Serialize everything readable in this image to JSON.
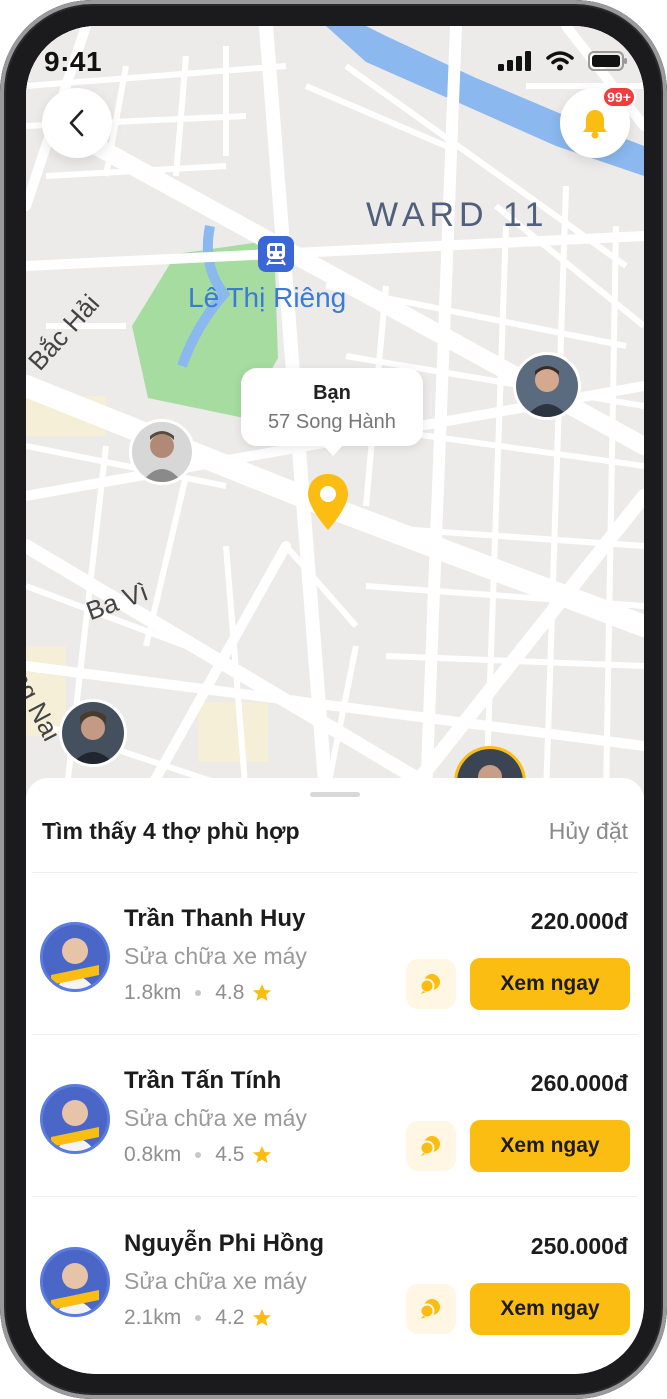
{
  "status_bar": {
    "time": "9:41"
  },
  "notifications": {
    "badge": "99+"
  },
  "map": {
    "ward_label": "WARD 11",
    "park_label": "Lê Thị Riêng",
    "streets": {
      "bac_hai": "Bắc Hải",
      "ba_vi": "Ba Vì",
      "dong_nai": "Đồng Nai"
    },
    "you_marker": {
      "title": "Bạn",
      "address": "57 Song Hành"
    }
  },
  "sheet": {
    "title": "Tìm thấy 4 thợ phù hợp",
    "cancel_label": "Hủy đặt",
    "workers": [
      {
        "name": "Trần Thanh Huy",
        "service": "Sửa chữa xe máy",
        "distance": "1.8km",
        "rating": "4.8",
        "price": "220.000đ",
        "button": "Xem ngay"
      },
      {
        "name": "Trần Tấn Tính",
        "service": "Sửa chữa xe máy",
        "distance": "0.8km",
        "rating": "4.5",
        "price": "260.000đ",
        "button": "Xem ngay"
      },
      {
        "name": "Nguyễn Phi Hồng",
        "service": "Sửa chữa xe máy",
        "distance": "2.1km",
        "rating": "4.2",
        "price": "250.000đ",
        "button": "Xem ngay"
      }
    ]
  },
  "colors": {
    "accent": "#fbbd12",
    "badge": "#f23b3b",
    "park": "#a6dca0",
    "water": "#8ab8ef"
  }
}
